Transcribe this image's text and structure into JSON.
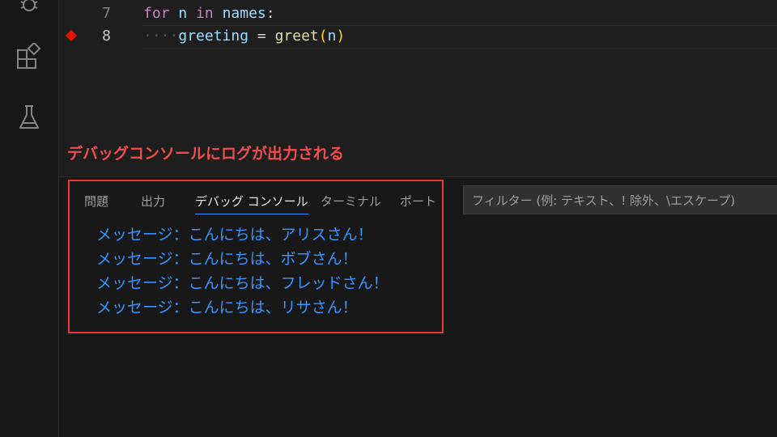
{
  "editor": {
    "lines": [
      {
        "number": "7",
        "keyword_for": "for",
        "var_n": "n",
        "keyword_in": "in",
        "iter": "names",
        "colon": ":"
      },
      {
        "number": "8",
        "indent_dots": "····",
        "var": "greeting",
        "op": " = ",
        "fn": "greet",
        "open": "(",
        "arg": "n",
        "close": ")"
      }
    ]
  },
  "caption": "デバッグコンソールにログが出力される",
  "panel": {
    "tabs": [
      "問題",
      "出力",
      "デバッグ コンソール",
      "ターミナル",
      "ポート"
    ],
    "filter_placeholder": "フィルター (例: テキスト、! 除外、\\エスケープ)",
    "logs": [
      "メッセージ：こんにちは、アリスさん！",
      "メッセージ：こんにちは、ボブさん！",
      "メッセージ：こんにちは、フレッドさん！",
      "メッセージ：こんにちは、リサさん！"
    ]
  },
  "icons": [
    "debug-icon",
    "extensions-icon",
    "testing-flask-icon"
  ],
  "colors": {
    "highlight": "#e53935",
    "log_text": "#3794ff",
    "caption": "#f14c4c",
    "breakpoint": "#e51400"
  }
}
